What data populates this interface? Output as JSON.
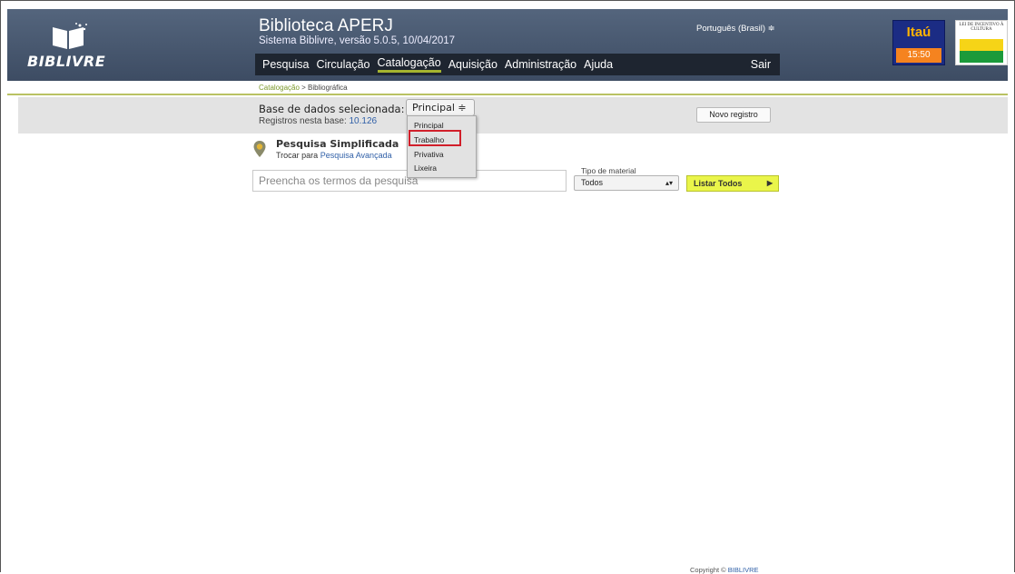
{
  "app": {
    "logo_text": "BIBLIVRE",
    "title": "Biblioteca APERJ",
    "subtitle": "Sistema Biblivre, versão 5.0.5, 10/04/2017",
    "language": "Português (Brasil) ≑"
  },
  "nav": {
    "items": [
      "Pesquisa",
      "Circulação",
      "Catalogação",
      "Aquisição",
      "Administração",
      "Ajuda"
    ],
    "active": "Catalogação",
    "exit": "Sair"
  },
  "sponsors": {
    "itau_label": "Itaú",
    "itau_clock": "15:50",
    "lei_text": "LEI DE INCENTIVO À CULTURA"
  },
  "breadcrumb": {
    "section": "Catalogação",
    "separator": " > ",
    "page": "Bibliográfica"
  },
  "database": {
    "label": "Base de dados selecionada:",
    "selected": "Principal ≑",
    "records_label": "Registros nesta base: ",
    "records_count": "10.126",
    "options": [
      "Principal",
      "Trabalho",
      "Privativa",
      "Lixeira"
    ],
    "highlighted_option": "Trabalho",
    "new_record_button": "Novo registro"
  },
  "search": {
    "title": "Pesquisa Simplificada",
    "switch_prefix": "Trocar para ",
    "switch_link": "Pesquisa Avançada",
    "placeholder": "Preencha os termos da pesquisa",
    "material_label": "Tipo de material",
    "material_selected": "Todos",
    "list_all_button": "Listar Todos"
  },
  "footer": {
    "prefix": "Copyright © ",
    "link": "BIBLIVRE"
  },
  "colors": {
    "header": "#4a5a72",
    "nav": "#1e2530",
    "accent_green": "#a5b42f",
    "list_button": "#eaf54a",
    "highlight_red": "#d11f2a",
    "link_blue": "#2f5fa7"
  }
}
